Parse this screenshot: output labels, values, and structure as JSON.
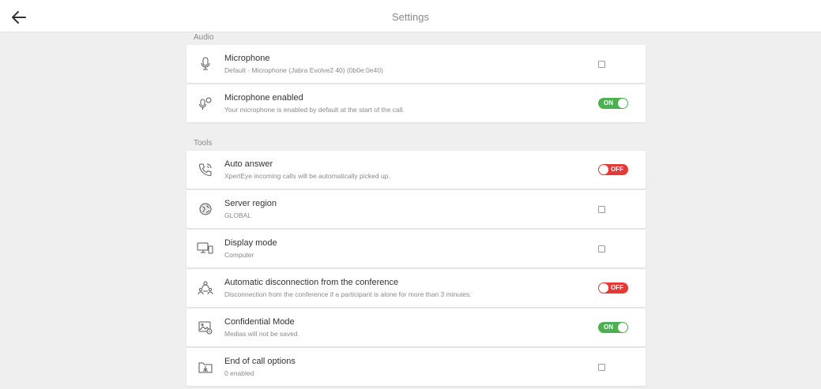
{
  "header": {
    "title": "Settings"
  },
  "sections": {
    "audio": {
      "label": "Audio"
    },
    "tools": {
      "label": "Tools"
    }
  },
  "settings": {
    "microphone": {
      "name": "Microphone",
      "sub": "Default - Microphone (Jabra Evolve2 40) (0b0e:0e40)"
    },
    "microphone_enabled": {
      "name": "Microphone enabled",
      "sub": "Your microphone is enabled by default at the start of the call.",
      "toggle": "ON"
    },
    "auto_answer": {
      "name": "Auto answer",
      "sub": "XpertEye incoming calls will be automatically picked up.",
      "toggle": "OFF"
    },
    "server_region": {
      "name": "Server region",
      "sub": "GLOBAL"
    },
    "display_mode": {
      "name": "Display mode",
      "sub": "Computer"
    },
    "auto_disconnect": {
      "name": "Automatic disconnection from the conference",
      "sub": "Disconnection from the conference if a participant is alone for more than 3 minutes.",
      "toggle": "OFF"
    },
    "confidential_mode": {
      "name": "Confidential Mode",
      "sub": "Medias will not be saved.",
      "toggle": "ON"
    },
    "end_of_call": {
      "name": "End of call options",
      "sub": "0 enabled"
    }
  },
  "colors": {
    "toggle_on": "#4caf50",
    "toggle_off": "#e53935",
    "background": "#efefef"
  }
}
